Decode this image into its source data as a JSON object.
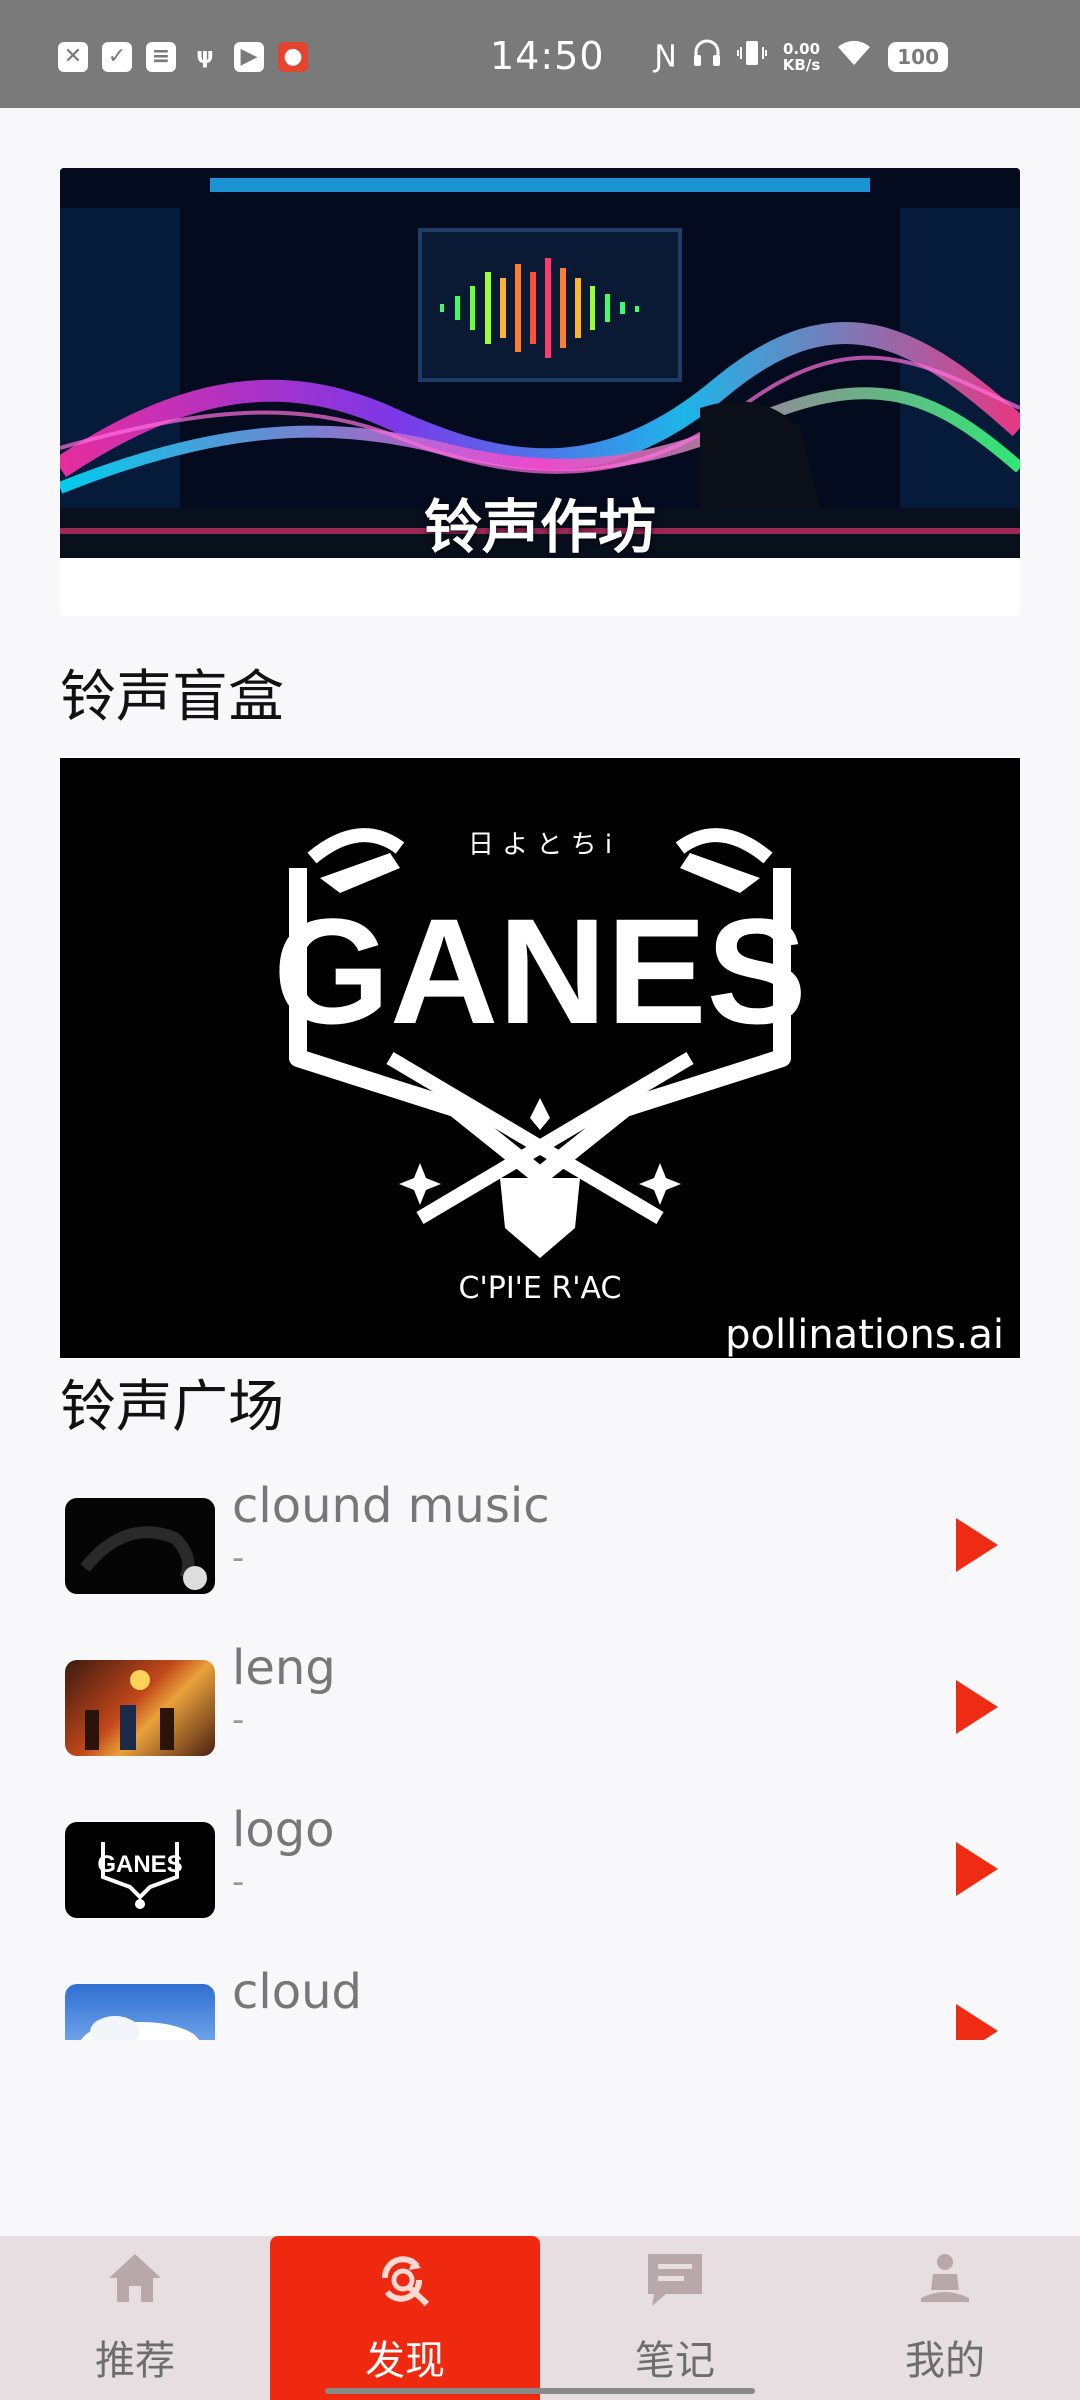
{
  "status_bar": {
    "time": "14:50",
    "net_speed_value": "0.00",
    "net_speed_unit": "KB/s",
    "battery": "100"
  },
  "banner": {
    "caption": "铃声作坊"
  },
  "sections": {
    "blind_box": "铃声盲盒",
    "plaza": "铃声广场"
  },
  "blind_box_image": {
    "logo_text": "GANES",
    "logo_top_text": "日 よ と ち i",
    "logo_bottom_text": "C'PI'E  R'AC",
    "watermark": "pollinations.ai"
  },
  "ringtones": [
    {
      "title": "clound music",
      "subtitle": "-"
    },
    {
      "title": "leng",
      "subtitle": "-"
    },
    {
      "title": "logo",
      "subtitle": "-"
    },
    {
      "title": "cloud",
      "subtitle": "-"
    }
  ],
  "tabs": [
    {
      "label": "推荐",
      "icon": "home-icon",
      "active": false
    },
    {
      "label": "发现",
      "icon": "discover-icon",
      "active": true
    },
    {
      "label": "笔记",
      "icon": "note-icon",
      "active": false
    },
    {
      "label": "我的",
      "icon": "profile-icon",
      "active": false
    }
  ],
  "colors": {
    "accent": "#ef2810",
    "play": "#ee2c14",
    "tabbar_bg": "#e6dee0",
    "statusbar_bg": "#7a7a7a"
  }
}
